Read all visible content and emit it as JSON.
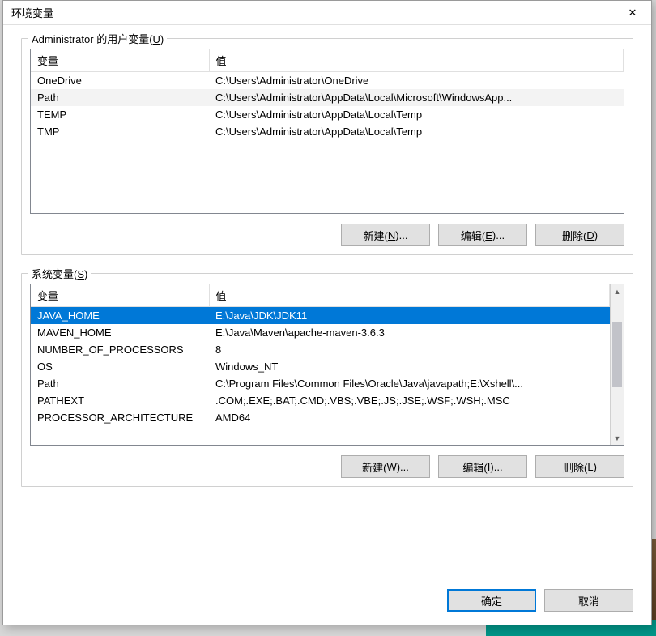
{
  "window": {
    "title": "环境变量",
    "close_icon": "✕"
  },
  "user_group": {
    "label_prefix": "Administrator 的用户变量(",
    "label_hotkey": "U",
    "label_suffix": ")",
    "header_var": "变量",
    "header_val": "值",
    "rows": [
      {
        "name": "OneDrive",
        "value": "C:\\Users\\Administrator\\OneDrive"
      },
      {
        "name": "Path",
        "value": "C:\\Users\\Administrator\\AppData\\Local\\Microsoft\\WindowsApp..."
      },
      {
        "name": "TEMP",
        "value": "C:\\Users\\Administrator\\AppData\\Local\\Temp"
      },
      {
        "name": "TMP",
        "value": "C:\\Users\\Administrator\\AppData\\Local\\Temp"
      }
    ],
    "highlighted_index": 1,
    "buttons": {
      "new": {
        "pre": "新建(",
        "hk": "N",
        "post": ")..."
      },
      "edit": {
        "pre": "编辑(",
        "hk": "E",
        "post": ")..."
      },
      "delete": {
        "pre": "删除(",
        "hk": "D",
        "post": ")"
      }
    }
  },
  "system_group": {
    "label_prefix": "系统变量(",
    "label_hotkey": "S",
    "label_suffix": ")",
    "header_var": "变量",
    "header_val": "值",
    "rows": [
      {
        "name": "JAVA_HOME",
        "value": "E:\\Java\\JDK\\JDK11"
      },
      {
        "name": "MAVEN_HOME",
        "value": "E:\\Java\\Maven\\apache-maven-3.6.3"
      },
      {
        "name": "NUMBER_OF_PROCESSORS",
        "value": "8"
      },
      {
        "name": "OS",
        "value": "Windows_NT"
      },
      {
        "name": "Path",
        "value": "C:\\Program Files\\Common Files\\Oracle\\Java\\javapath;E:\\Xshell\\..."
      },
      {
        "name": "PATHEXT",
        "value": ".COM;.EXE;.BAT;.CMD;.VBS;.VBE;.JS;.JSE;.WSF;.WSH;.MSC"
      },
      {
        "name": "PROCESSOR_ARCHITECTURE",
        "value": "AMD64"
      }
    ],
    "selected_index": 0,
    "buttons": {
      "new": {
        "pre": "新建(",
        "hk": "W",
        "post": ")..."
      },
      "edit": {
        "pre": "编辑(",
        "hk": "I",
        "post": ")..."
      },
      "delete": {
        "pre": "删除(",
        "hk": "L",
        "post": ")"
      }
    }
  },
  "footer": {
    "ok": "确定",
    "cancel": "取消"
  }
}
